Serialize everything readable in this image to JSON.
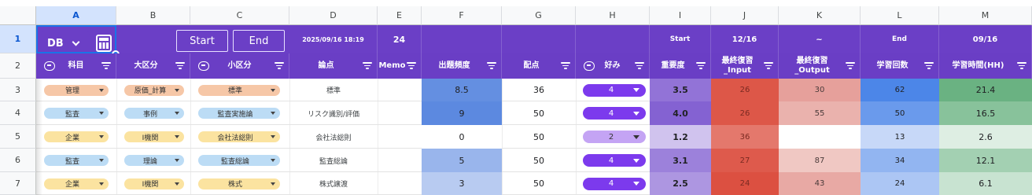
{
  "columns": [
    "A",
    "B",
    "C",
    "D",
    "E",
    "F",
    "G",
    "H",
    "I",
    "J",
    "K",
    "L",
    "M"
  ],
  "rows": [
    "1",
    "2",
    "3",
    "4",
    "5",
    "6",
    "7"
  ],
  "toolbar": {
    "db_label": "DB",
    "start_label": "Start",
    "end_label": "End",
    "datetime": "2025/09/16 18:19",
    "e1_value": "24",
    "i1_label": "Start",
    "j1_value": "12/16",
    "k1_value": "~",
    "l1_label": "End",
    "m1_value": "09/16"
  },
  "headers": {
    "a": "科目",
    "b": "大区分",
    "c": "小区分",
    "d": "論点",
    "e": "Memo",
    "f": "出題頻度",
    "g": "配点",
    "h": "好み",
    "i": "重要度",
    "j_line1": "最終復習",
    "j_line2": "_Input",
    "k_line1": "最終復習",
    "k_line2": "_Output",
    "l": "学習回数",
    "m": "学習時間(HH)"
  },
  "table_rows": [
    {
      "subject": "管理",
      "major": "原価_計算",
      "minor": "標準",
      "topic": "標準",
      "memo": "",
      "freq": "8.5",
      "points": "36",
      "pref": "4",
      "importance": "3.5",
      "input": "26",
      "output": "30",
      "count": "62",
      "hours": "21.4"
    },
    {
      "subject": "監査",
      "major": "事例",
      "minor": "監査実施論",
      "topic": "リスク識別/評価",
      "memo": "",
      "freq": "9",
      "points": "50",
      "pref": "4",
      "importance": "4.0",
      "input": "26",
      "output": "55",
      "count": "50",
      "hours": "16.5"
    },
    {
      "subject": "企業",
      "major": "I機関",
      "minor": "会社法総則",
      "topic": "会社法総則",
      "memo": "",
      "freq": "0",
      "points": "50",
      "pref": "2",
      "importance": "1.2",
      "input": "36",
      "output": "",
      "count": "13",
      "hours": "2.6"
    },
    {
      "subject": "監査",
      "major": "理論",
      "minor": "監査総論",
      "topic": "監査総論",
      "memo": "",
      "freq": "5",
      "points": "50",
      "pref": "4",
      "importance": "3.1",
      "input": "27",
      "output": "87",
      "count": "34",
      "hours": "12.1"
    },
    {
      "subject": "企業",
      "major": "I機関",
      "minor": "株式",
      "topic": "株式譲渡",
      "memo": "",
      "freq": "3",
      "points": "50",
      "pref": "4",
      "importance": "2.5",
      "input": "24",
      "output": "43",
      "count": "24",
      "hours": "6.1"
    }
  ],
  "colors": {
    "header_band": "#6b3fc6",
    "chip_kanri": "#f6c7a7",
    "chip_kansa": "#bcdcf5",
    "chip_kigyo": "#fbe3a0",
    "pref_strong": "#7c3aed",
    "pref_light": "#c4a4f4"
  }
}
